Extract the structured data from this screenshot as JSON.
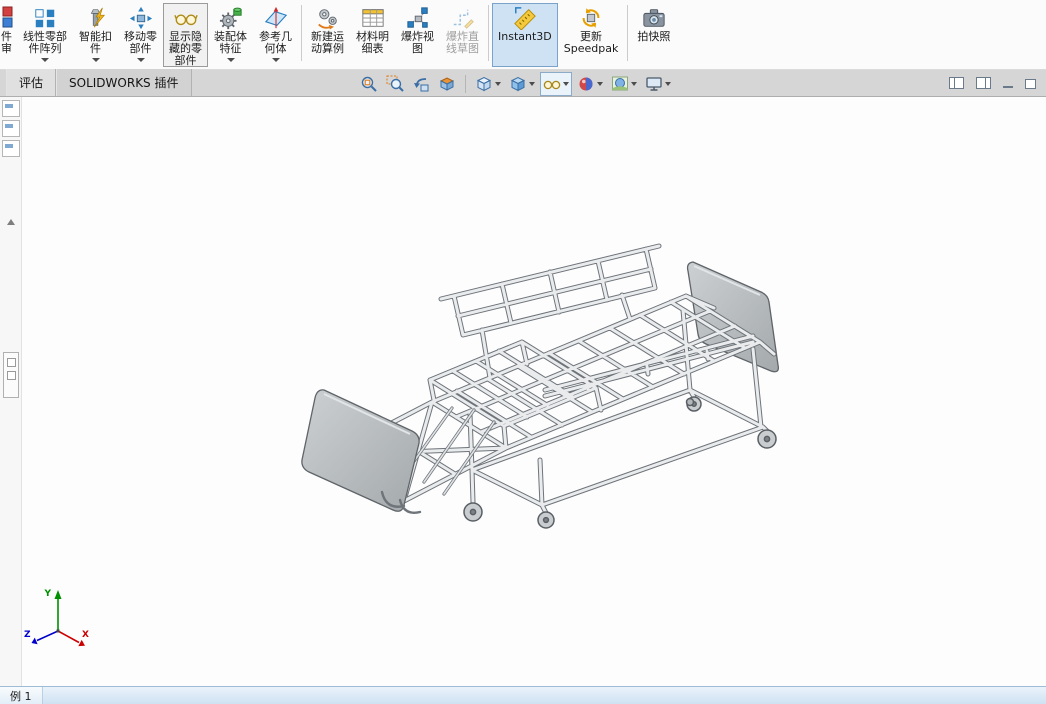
{
  "ribbon": {
    "partial": {
      "line1": "件",
      "line2": "审"
    },
    "buttons": [
      {
        "name": "linear-component-pattern",
        "line1": "线性零部",
        "line2": "件阵列",
        "dropdown": true
      },
      {
        "name": "smart-fasteners",
        "line1": "智能扣",
        "line2": "件",
        "dropdown": true
      },
      {
        "name": "move-component",
        "line1": "移动零",
        "line2": "部件",
        "dropdown": true
      },
      {
        "name": "show-hidden-components",
        "line1": "显示隐",
        "line2": "藏的零",
        "line3": "部件",
        "pressed": true
      },
      {
        "name": "assembly-features",
        "line1": "装配体",
        "line2": "特征",
        "dropdown": true
      },
      {
        "name": "reference-geometry",
        "line1": "参考几",
        "line2": "何体",
        "dropdown": true
      },
      {
        "name": "new-motion-study",
        "line1": "新建运",
        "line2": "动算例"
      },
      {
        "name": "bill-of-materials",
        "line1": "材料明",
        "line2": "细表"
      },
      {
        "name": "exploded-view",
        "line1": "爆炸视",
        "line2": "图"
      },
      {
        "name": "explode-line-sketch",
        "line1": "爆炸直",
        "line2": "线草图",
        "disabled": true
      },
      {
        "name": "instant3d",
        "line1": "Instant3D",
        "selected": true
      },
      {
        "name": "update-speedpak",
        "line1": "更新",
        "line2": "Speedpak"
      },
      {
        "name": "take-snapshot",
        "line1": "拍快照"
      }
    ]
  },
  "command_tabs": [
    {
      "label": "评估"
    },
    {
      "label": "SOLIDWORKS 插件"
    }
  ],
  "heads_up_toolbar": {
    "icons": [
      {
        "name": "zoom-to-fit"
      },
      {
        "name": "zoom-to-area"
      },
      {
        "name": "previous-view"
      },
      {
        "name": "section-view"
      },
      {
        "name": "view-orientation",
        "dropdown": true
      },
      {
        "name": "display-style",
        "dropdown": true
      },
      {
        "name": "hide-show-items",
        "dropdown": true,
        "active": true
      },
      {
        "name": "edit-appearance",
        "dropdown": true
      },
      {
        "name": "apply-scene",
        "dropdown": true
      },
      {
        "name": "view-settings",
        "dropdown": true
      }
    ]
  },
  "window_controls": {
    "icons": [
      "split-pane-left",
      "split-pane-right",
      "minimize",
      "restore"
    ]
  },
  "viewport": {
    "content": "3d-assembly-hospital-bed-frame",
    "triad": {
      "x_label": "X",
      "y_label": "Y",
      "z_label": "Z"
    }
  },
  "status_bar": {
    "left_text": "例 1"
  },
  "colors": {
    "instant3d_highlight": "#cfe2f4",
    "instant3d_border": "#7ba2c8",
    "tab_strip": "#d6d6d6",
    "status_bar": "#d8e8f5",
    "triad_x": "#cc0000",
    "triad_y": "#008f00",
    "triad_z": "#0000cc"
  }
}
